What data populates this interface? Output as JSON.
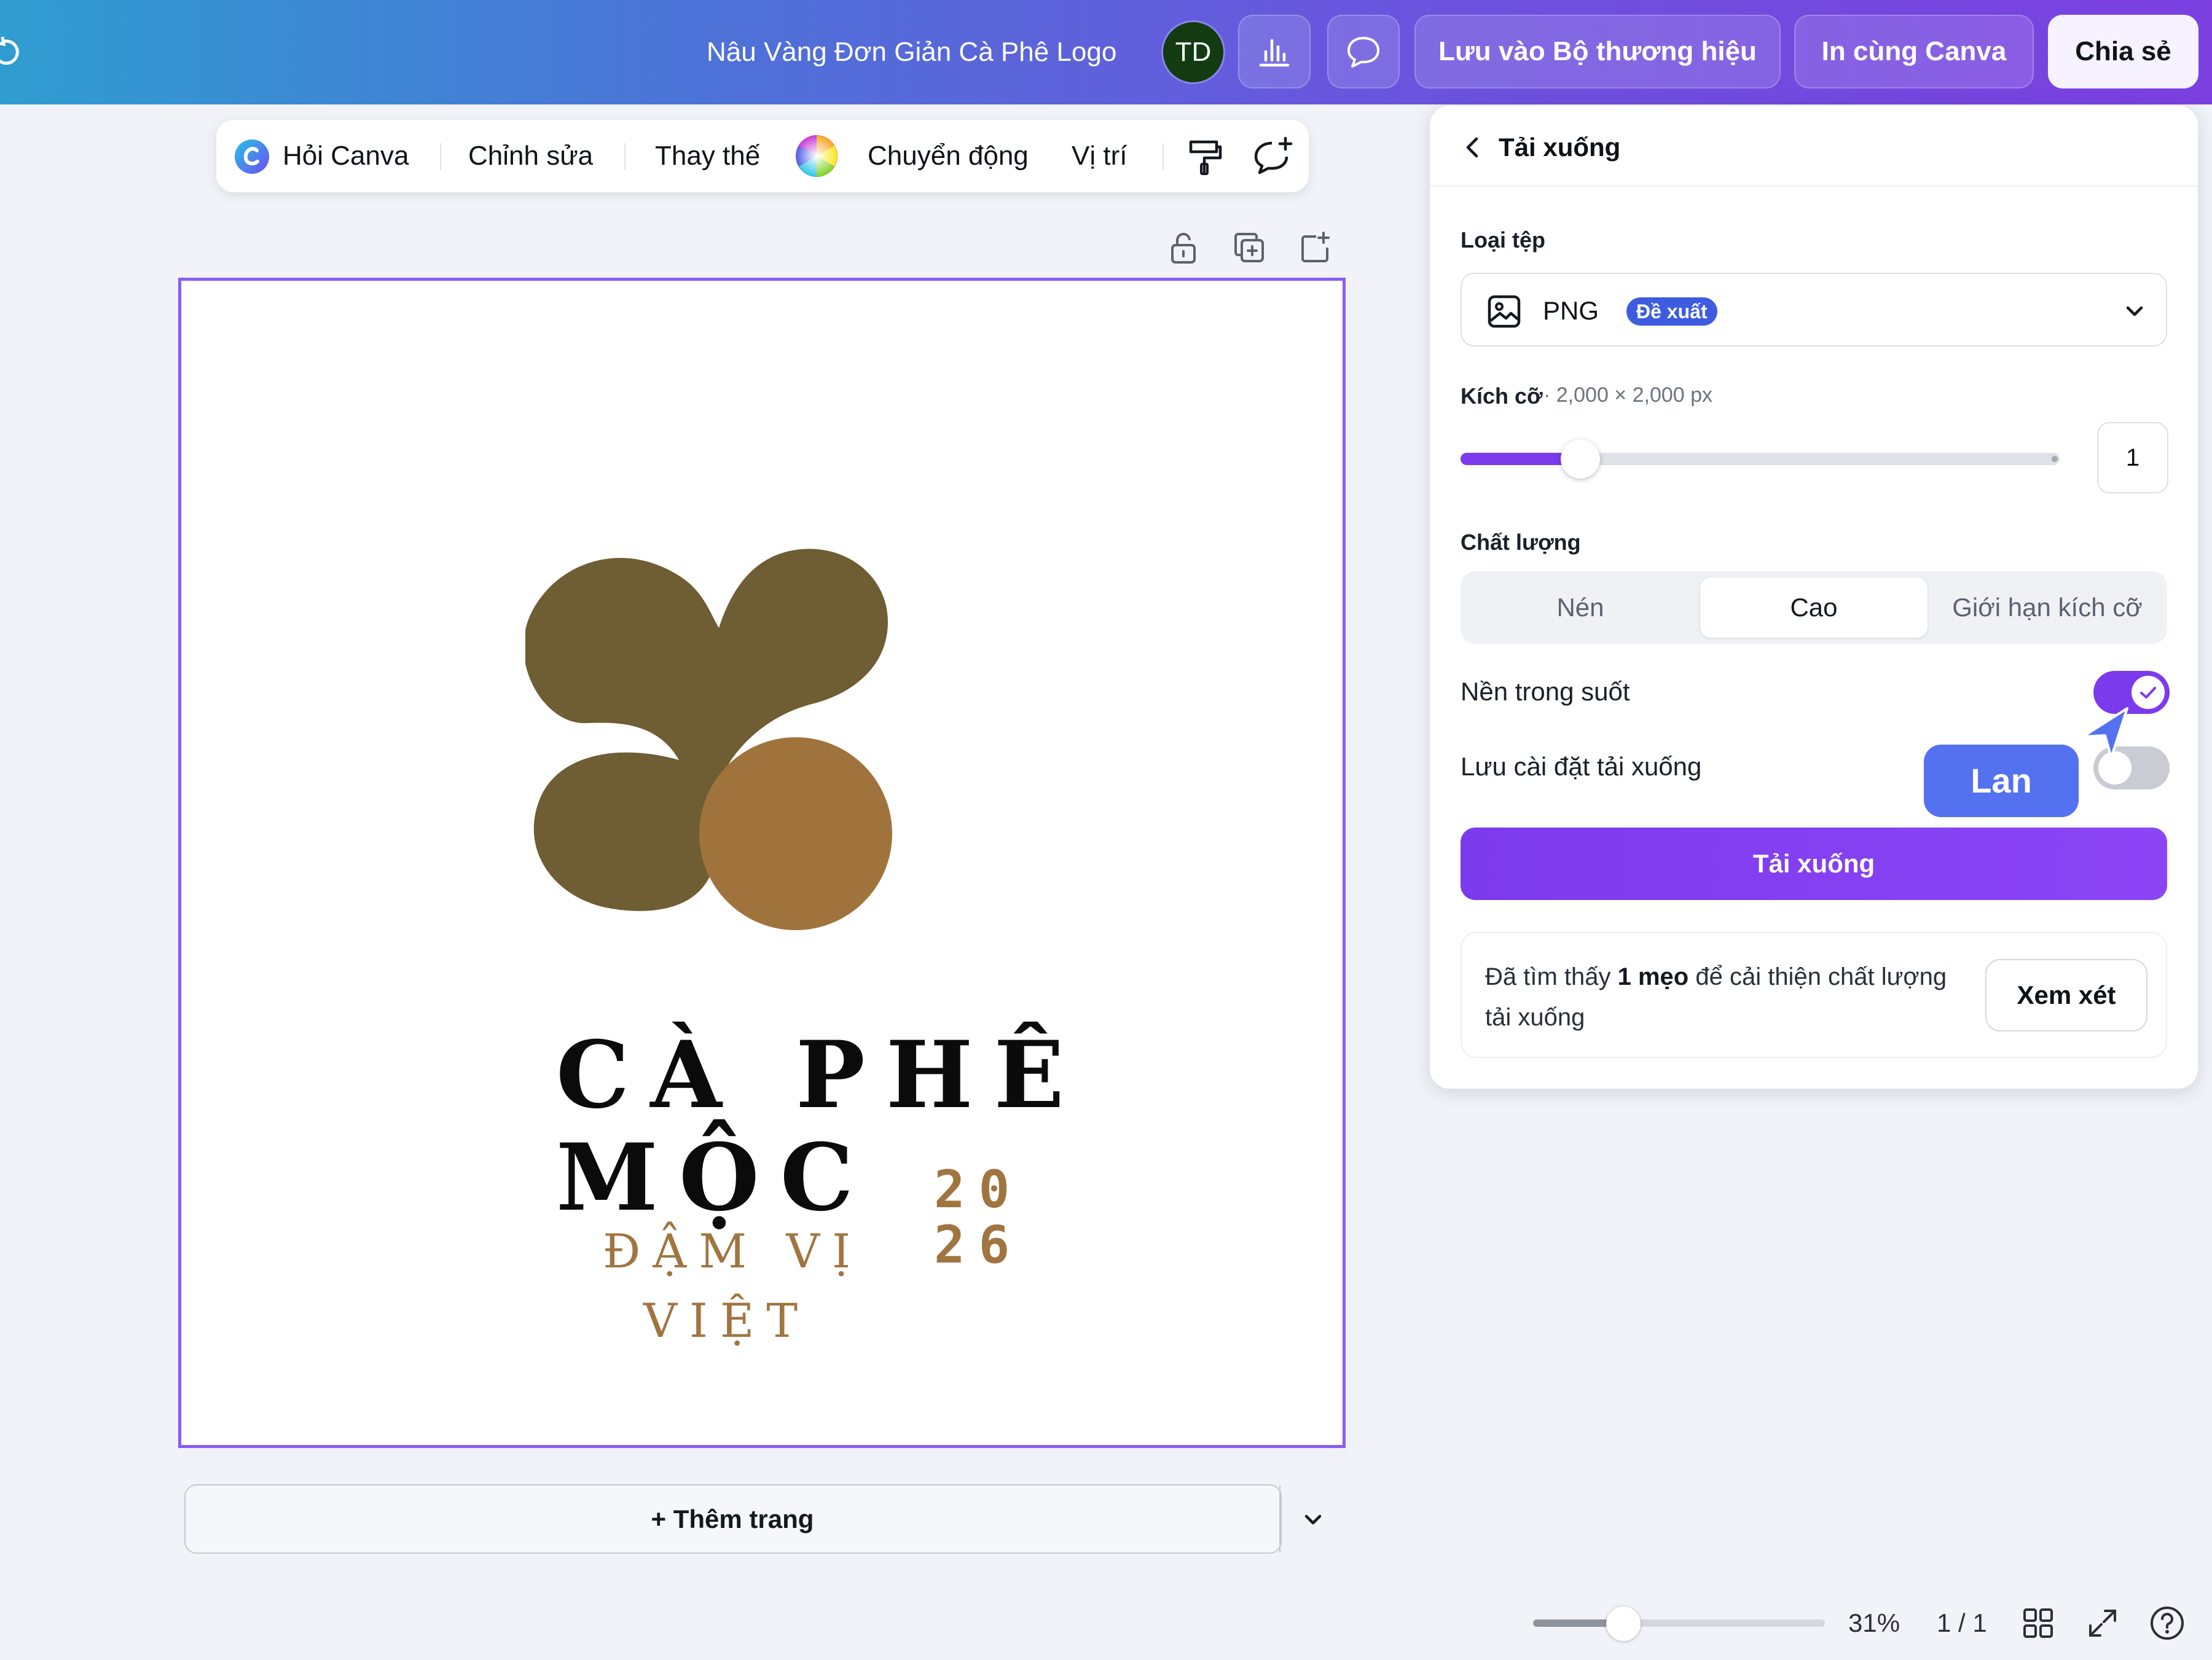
{
  "topbar": {
    "document_title": "Nâu Vàng Đơn Giản Cà Phê Logo",
    "avatar_initials": "TD",
    "save_brand_label": "Lưu vào Bộ thương hiệu",
    "print_label": "In cùng Canva",
    "share_label": "Chia sẻ",
    "icons": [
      "undo-icon",
      "insights-icon",
      "comment-icon"
    ]
  },
  "context_toolbar": {
    "ask_canva": "Hỏi Canva",
    "edit": "Chỉnh sửa",
    "replace": "Thay thế",
    "animate": "Chuyển động",
    "position": "Vị trí",
    "icons": [
      "canva-ai-icon",
      "color-wheel-icon",
      "format-painter-icon",
      "add-comment-icon"
    ]
  },
  "page_actions": {
    "icons": [
      "lock-icon",
      "duplicate-icon",
      "add-page-icon"
    ]
  },
  "design": {
    "line1": "CÀ PHÊ",
    "line2": "MỘC",
    "line3": "ĐẬM VỊ",
    "line4": "VIỆT",
    "year_top": "20",
    "year_bottom": "26",
    "colors": {
      "dark_brown": "#6f5d33",
      "light_brown": "#a0733c"
    }
  },
  "add_page": {
    "label": "+ Thêm trang"
  },
  "status_bar": {
    "zoom_fraction": 0.31,
    "zoom": "31%",
    "page_counter": "1 / 1",
    "icons": [
      "grid-view-icon",
      "fullscreen-icon",
      "help-icon"
    ]
  },
  "download_panel": {
    "title": "Tải xuống",
    "file_type_label": "Loại tệp",
    "file_type_value": "PNG",
    "recommended_badge": "Đề xuất",
    "size_label": "Kích cỡ",
    "size_detail": "· 2,000 × 2,000 px",
    "size_multiplier": "1",
    "size_slider_fraction": 0.2,
    "quality_label": "Chất lượng",
    "quality_options": [
      "Nén",
      "Cao",
      "Giới hạn kích cỡ"
    ],
    "quality_selected": "Cao",
    "transparent_bg_label": "Nền trong suốt",
    "transparent_bg_on": true,
    "save_settings_label": "Lưu cài đặt tải xuống",
    "save_settings_on": false,
    "download_button": "Tải xuống",
    "tip_prefix": "Đã tìm thấy ",
    "tip_bold": "1 mẹo",
    "tip_suffix": " để cải thiện chất lượng tải xuống",
    "review_button": "Xem xét"
  },
  "collaborator_cursor": {
    "name": "Lan",
    "color": "#5471f0"
  },
  "accent_color": "#7c3aed"
}
